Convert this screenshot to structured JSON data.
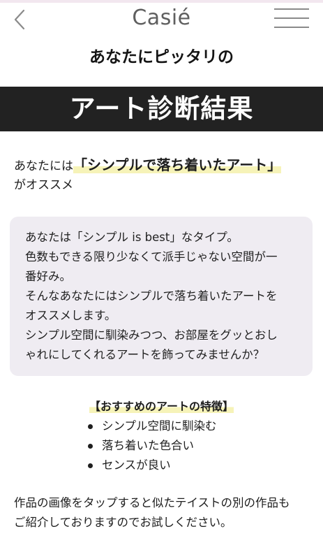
{
  "header": {
    "brand": "Casié",
    "back_icon": "chevron-left-icon",
    "menu_icon": "hamburger-menu-icon"
  },
  "hero": {
    "kicker": "あなたにピッタリの",
    "banner": "アート診断結果"
  },
  "result": {
    "prefix": "あなたには",
    "highlight": "「シンプルで落ち着いたアート」",
    "suffix": "がオススメ"
  },
  "description": {
    "lines": [
      "あなたは「シンプル is best」なタイプ。",
      "色数もできる限り少なくて派手じゃない空間が一",
      "番好み。",
      "そんなあなたにはシンプルで落ち着いたアートを",
      "オススメします。",
      "シンプル空間に馴染みつつ、お部屋をグッとおし",
      "ゃれにしてくれるアートを飾ってみませんか？"
    ]
  },
  "features": {
    "title": "【おすすめのアートの特徴】",
    "items": [
      "シンプル空間に馴染む",
      "落ち着いた色合い",
      "センスが良い"
    ]
  },
  "footer_note": {
    "lines": [
      "作品の画像をタップすると似たテイストの別の作品も",
      "ご紹介しておりますのでお試しください。"
    ]
  },
  "colors": {
    "banner_bg": "#222222",
    "box_bg": "#efecf2",
    "highlight": "#f6f3b8"
  }
}
